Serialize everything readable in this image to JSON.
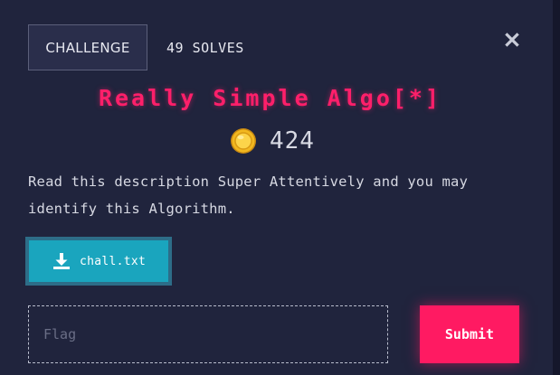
{
  "tabs": {
    "challenge_label": "CHALLENGE",
    "solves_label": "49 SOLVES"
  },
  "challenge": {
    "title": "Really Simple Algo[*]",
    "points": "424",
    "description": "Read this description Super Attentively and you may identify this Algorithm.",
    "file_name": "chall.txt"
  },
  "form": {
    "flag_placeholder": "Flag",
    "submit_label": "Submit"
  },
  "icons": {
    "close": "close-icon",
    "coin": "coin-icon",
    "download": "download-icon"
  },
  "colors": {
    "background": "#20243d",
    "title": "#ff1f6a",
    "file_button": "#1aa5be",
    "submit_button": "#ff1a62"
  }
}
